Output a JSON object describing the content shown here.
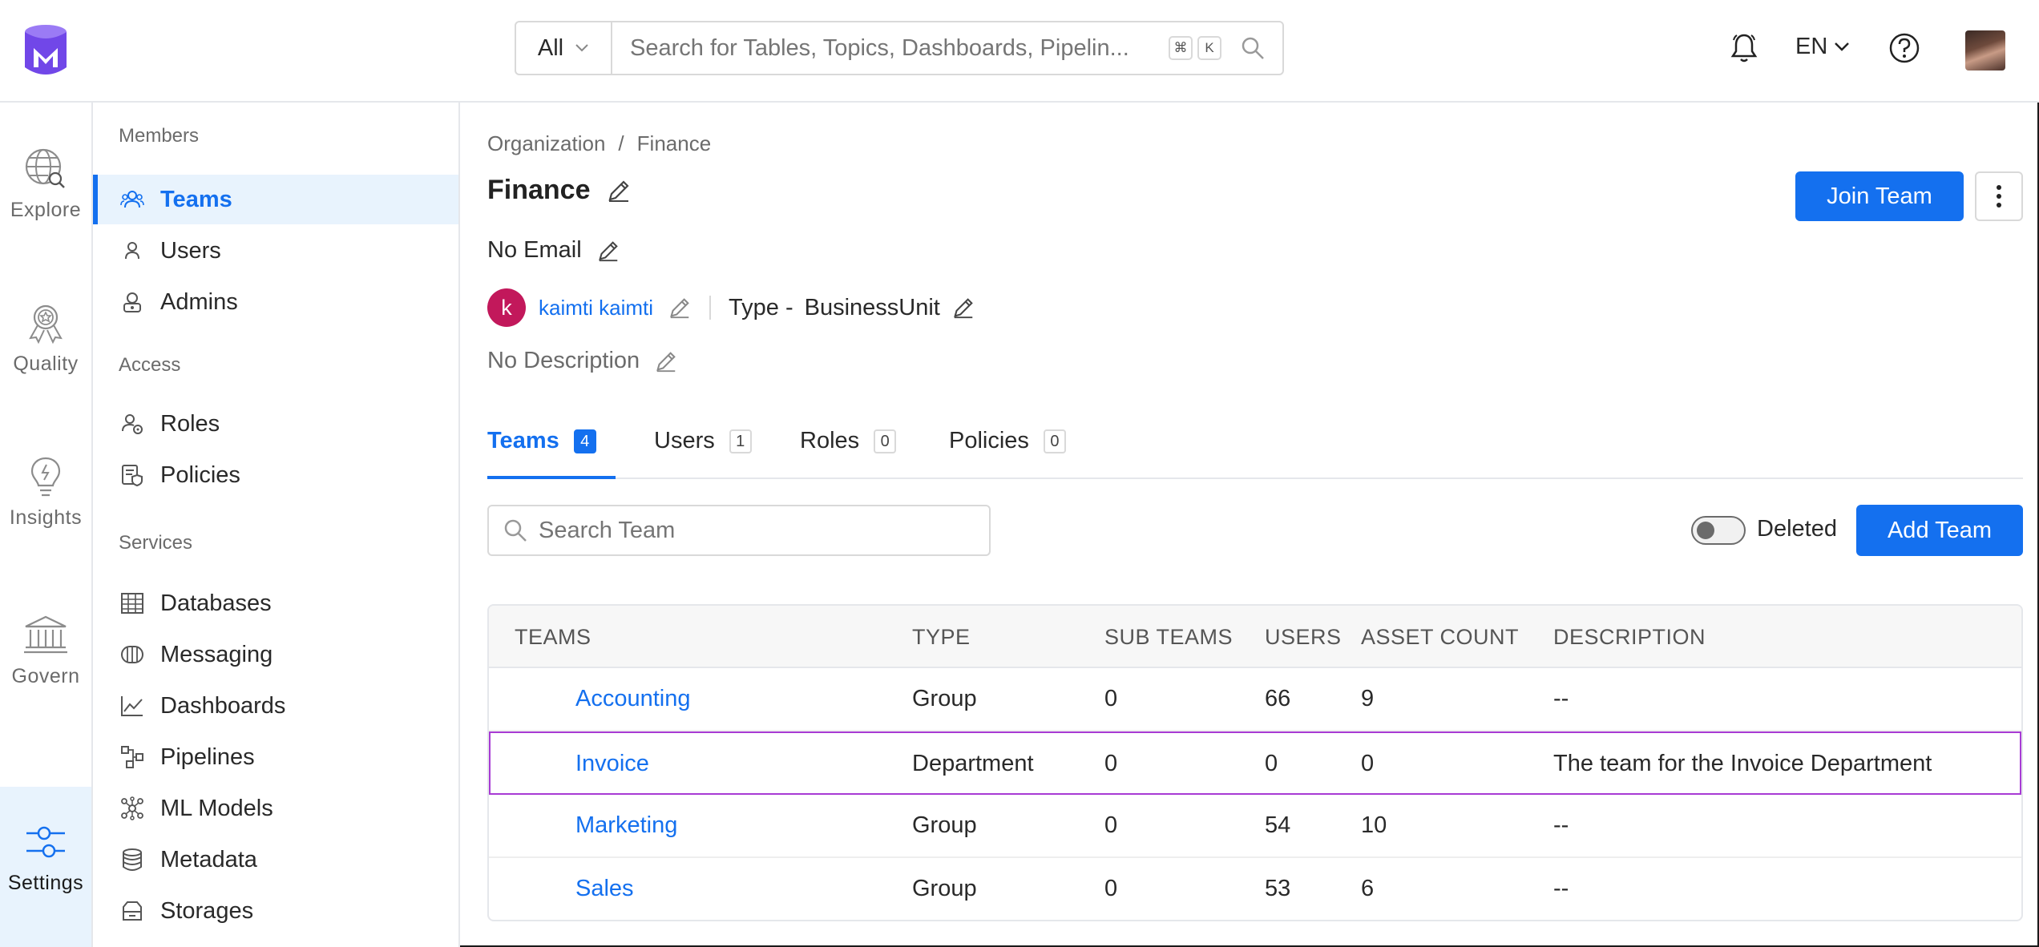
{
  "search": {
    "scope": "All",
    "placeholder": "Search for Tables, Topics, Dashboards, Pipelin...",
    "shortcut_1": "⌘",
    "shortcut_2": "K"
  },
  "topbar": {
    "language": "EN"
  },
  "rail": [
    {
      "label": "Explore",
      "icon": "explore-icon"
    },
    {
      "label": "Quality",
      "icon": "quality-icon"
    },
    {
      "label": "Insights",
      "icon": "insights-icon"
    },
    {
      "label": "Govern",
      "icon": "govern-icon"
    },
    {
      "label": "Settings",
      "icon": "settings-icon"
    }
  ],
  "sidemenu": {
    "sections": [
      "Members",
      "Access",
      "Services"
    ],
    "items": [
      {
        "label": "Teams",
        "icon": "teams-icon"
      },
      {
        "label": "Users",
        "icon": "user-icon"
      },
      {
        "label": "Admins",
        "icon": "admin-icon"
      },
      {
        "label": "Roles",
        "icon": "roles-icon"
      },
      {
        "label": "Policies",
        "icon": "policies-icon"
      },
      {
        "label": "Databases",
        "icon": "database-icon"
      },
      {
        "label": "Messaging",
        "icon": "messaging-icon"
      },
      {
        "label": "Dashboards",
        "icon": "dashboard-icon"
      },
      {
        "label": "Pipelines",
        "icon": "pipeline-icon"
      },
      {
        "label": "ML Models",
        "icon": "ml-model-icon"
      },
      {
        "label": "Metadata",
        "icon": "metadata-icon"
      },
      {
        "label": "Storages",
        "icon": "storage-icon"
      }
    ]
  },
  "breadcrumb": {
    "root": "Organization",
    "sep": "/",
    "current": "Finance"
  },
  "team": {
    "name": "Finance",
    "email": "No Email",
    "owner_initial": "k",
    "owner": "kaimti kaimti",
    "type_label": "Type -",
    "type_value": "BusinessUnit",
    "description": "No Description",
    "owner_color": "#c2185b"
  },
  "buttons": {
    "join": "Join Team",
    "add": "Add Team",
    "deleted": "Deleted"
  },
  "tabs": [
    {
      "label": "Teams",
      "count": "4"
    },
    {
      "label": "Users",
      "count": "1"
    },
    {
      "label": "Roles",
      "count": "0"
    },
    {
      "label": "Policies",
      "count": "0"
    }
  ],
  "team_search": {
    "placeholder": "Search Team"
  },
  "table": {
    "headers": [
      "TEAMS",
      "TYPE",
      "SUB TEAMS",
      "USERS",
      "ASSET COUNT",
      "DESCRIPTION"
    ],
    "rows": [
      {
        "name": "Accounting",
        "type": "Group",
        "sub_teams": "0",
        "users": "66",
        "assets": "9",
        "description": "--"
      },
      {
        "name": "Invoice",
        "type": "Department",
        "sub_teams": "0",
        "users": "0",
        "assets": "0",
        "description": "The team for the Invoice Department"
      },
      {
        "name": "Marketing",
        "type": "Group",
        "sub_teams": "0",
        "users": "54",
        "assets": "10",
        "description": "--"
      },
      {
        "name": "Sales",
        "type": "Group",
        "sub_teams": "0",
        "users": "53",
        "assets": "6",
        "description": "--"
      }
    ]
  },
  "colors": {
    "accent": "#1470ef",
    "highlight_row": "#a83bd4",
    "logo": "#7147e8"
  }
}
